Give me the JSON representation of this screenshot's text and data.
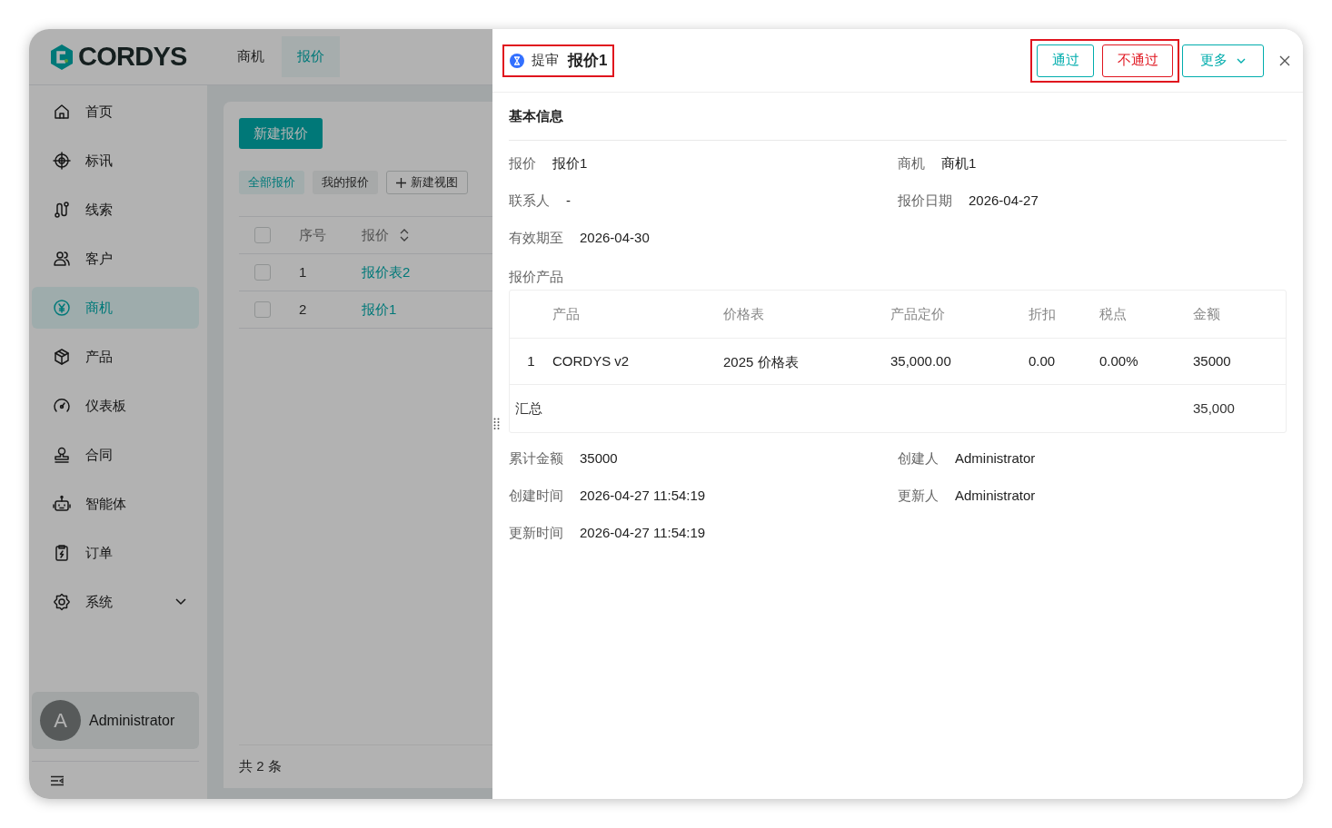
{
  "app": {
    "logo": "CORDYS",
    "top_tabs": [
      {
        "label": "商机",
        "selected": false
      },
      {
        "label": "报价",
        "selected": true
      }
    ],
    "sidebar": {
      "items": [
        {
          "label": "首页",
          "selected": false
        },
        {
          "label": "标讯",
          "selected": false
        },
        {
          "label": "线索",
          "selected": false
        },
        {
          "label": "客户",
          "selected": false
        },
        {
          "label": "商机",
          "selected": true
        },
        {
          "label": "产品",
          "selected": false
        },
        {
          "label": "仪表板",
          "selected": false
        },
        {
          "label": "合同",
          "selected": false
        },
        {
          "label": "智能体",
          "selected": false
        },
        {
          "label": "订单",
          "selected": false
        },
        {
          "label": "系统",
          "selected": false,
          "expanded": false
        }
      ]
    },
    "user": {
      "avatar_letter": "A",
      "name": "Administrator"
    }
  },
  "list": {
    "new_button": "新建报价",
    "views": [
      {
        "label": "全部报价",
        "selected": true
      },
      {
        "label": "我的报价",
        "selected": false
      }
    ],
    "new_view": "新建视图",
    "columns": [
      "序号",
      "报价"
    ],
    "header_checked": false,
    "rows": [
      {
        "index": "1",
        "name": "报价表2",
        "checked": false
      },
      {
        "index": "2",
        "name": "报价1",
        "checked": false
      }
    ],
    "total": "共 2 条"
  },
  "drawer": {
    "status": "提审",
    "title": "报价1",
    "actions": [
      {
        "label": "通过",
        "kind": "approve"
      },
      {
        "label": "不通过",
        "kind": "reject"
      }
    ],
    "more": "更多",
    "section": "基本信息",
    "fields": [
      {
        "label": "报价",
        "value": "报价1"
      },
      {
        "label": "商机",
        "value": "商机1"
      },
      {
        "label": "联系人",
        "value": "-"
      },
      {
        "label": "报价日期",
        "value": "2026-04-27"
      },
      {
        "label": "有效期至",
        "value": "2026-04-30"
      }
    ],
    "products_label": "报价产品",
    "products": {
      "columns": [
        "",
        "产品",
        "价格表",
        "产品定价",
        "折扣",
        "税点",
        "金额"
      ],
      "rows": [
        [
          "1",
          "CORDYS v2",
          "2025 价格表",
          "35,000.00",
          "0.00",
          "0.00%",
          "35000"
        ]
      ],
      "summary_label": "汇总",
      "summary_value": "35,000"
    },
    "meta_fields": [
      {
        "label": "累计金额",
        "value": "35000"
      },
      {
        "label": "创建人",
        "value": "Administrator"
      },
      {
        "label": "创建时间",
        "value": "2026-04-27 11:54:19"
      },
      {
        "label": "更新人",
        "value": "Administrator"
      },
      {
        "label": "更新时间",
        "value": "2026-04-27 11:54:19"
      }
    ]
  }
}
